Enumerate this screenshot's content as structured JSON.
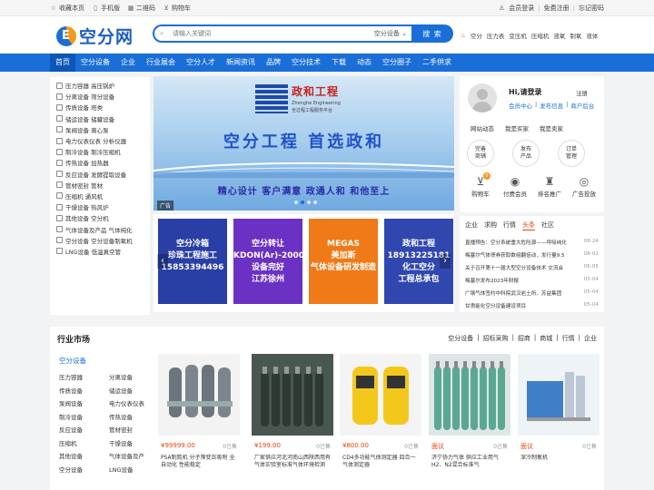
{
  "topbar": {
    "left": [
      {
        "icon": "bookmark-icon",
        "glyph": "☆",
        "label": "收藏本页"
      },
      {
        "icon": "mobile-icon",
        "glyph": "▯",
        "label": "手机版"
      },
      {
        "icon": "qrcode-icon",
        "glyph": "▦",
        "label": "二维码"
      },
      {
        "icon": "cart-icon",
        "glyph": "⊻",
        "label": "购物车"
      }
    ],
    "right": {
      "login": "会员登录",
      "register": "免费注册",
      "forgot": "忘记密码"
    }
  },
  "header": {
    "logo_text": "空分网",
    "search_placeholder": "请输入关键词",
    "search_category": "空分设备 ⌄",
    "search_button": "搜 索"
  },
  "hotwords": {
    "items": [
      "空分",
      "压力表",
      "变压机",
      "压缩机",
      "液氧",
      "制氧",
      "液体"
    ]
  },
  "nav": {
    "items": [
      "首页",
      "空分设备",
      "企业",
      "行业展会",
      "空分人才",
      "新闻资讯",
      "品牌",
      "空分技术",
      "下载",
      "动态",
      "空分圈子",
      "二手供求"
    ]
  },
  "categories": [
    "压力容器 高压锅炉",
    "分离设备 筛分设备",
    "传质设备 塔类",
    "储运设备 储藏设备",
    "泵阀设备 离心泵",
    "电力仪表仪表 分析仪器",
    "制冷设备 制冷压缩机",
    "传热设备 加热器",
    "反应设备 发酵提取设备",
    "管材密封 管材",
    "压缩机 通风机",
    "干燥设备 热风炉",
    "其他设备 空分机",
    "气体设备及产品 气体纯化",
    "空分设备 空分设备制氧机",
    "LNG设备 低温真空管"
  ],
  "banner": {
    "brand_cn": "政和工程",
    "brand_en": "Zhenghe Engineering",
    "brand_sub": "全过程工程服务平台",
    "title": "空分工程 首选政和",
    "slogan": "精心设计 客户满意 政通人和 和他至上",
    "ad_tag": "广告"
  },
  "tiles": [
    {
      "bg": "#2a3fa5",
      "text": "空分冷箱\n珍珠工程施工\n15853394496"
    },
    {
      "bg": "#6b31c4",
      "text": "空分转让\nKDON(Ar)-20000\n设备完好\n江苏徐州"
    },
    {
      "bg": "#f07a17",
      "text": "MEGAS\n美加斯\n气体设备研发制造"
    },
    {
      "bg": "#3047b0",
      "text": "政和工程\n18913225181\n化工空分\n工程总承包"
    }
  ],
  "user": {
    "greeting": "Hi,请登录",
    "register": "注册",
    "links": [
      "会员中心",
      "发布信息",
      "商户后台"
    ],
    "tabs": [
      "网站动态",
      "我是买家",
      "我是卖家"
    ],
    "circles": [
      "完善\n商铺",
      "发布\n产品",
      "订单\n管理"
    ],
    "icons": [
      {
        "name": "cart-icon",
        "glyph": "⊻",
        "label": "购物车",
        "badge": "0"
      },
      {
        "name": "wallet-icon",
        "glyph": "◉",
        "label": "付费会员"
      },
      {
        "name": "rank-icon",
        "glyph": "♜",
        "label": "排名推广"
      },
      {
        "name": "ad-icon",
        "glyph": "◎",
        "label": "广告投放"
      }
    ]
  },
  "news": {
    "tabs": [
      "企业",
      "求购",
      "行情",
      "头条",
      "社区"
    ],
    "active": "头条",
    "items": [
      {
        "t": "直播预告：空分系统重大危险源——呼吸纯化",
        "d": "08-24"
      },
      {
        "t": "梅塞尔气体债券获取数组翻倍动，发行量9.5",
        "d": "08-02"
      },
      {
        "t": "关于召开第十一届大型空分设备技术 交流会",
        "d": "06-05"
      },
      {
        "t": "梅塞尔发布2023年财报",
        "d": "05-04"
      },
      {
        "t": "广钢气体签约中科院武汉岩土所、苏益集团",
        "d": "05-04"
      },
      {
        "t": "甘肃能化空分设备建设项目",
        "d": "05-04"
      }
    ]
  },
  "market": {
    "title": "行业市场",
    "links": [
      "空分设备",
      "招标采购",
      "招商",
      "商城",
      "行情",
      "企业"
    ],
    "side_title": "空分设备",
    "side_items": [
      "压力容器",
      "分离设备",
      "传质设备",
      "储运设备",
      "泵阀设备",
      "电力仪表仪表",
      "制冷设备",
      "传热设备",
      "反应设备",
      "管材密封",
      "压缩机",
      "干燥设备",
      "其他设备",
      "气体设备及产",
      "空分设备",
      "LNG设备"
    ],
    "products": [
      {
        "price": "¥99999.00",
        "sold": "0已售",
        "name": "PSA制氮机 分子筛变压吸附 全自动化 性能稳定",
        "kind": "tanks"
      },
      {
        "price": "¥199.00",
        "sold": "0已售",
        "name": "厂家供应河北河南山西陕西用有气体实验室标准气体环境检测",
        "kind": "cylinders-dark"
      },
      {
        "price": "¥800.00",
        "sold": "0已售",
        "name": "CD4多功能气体测定器 四合一气体测定器",
        "kind": "detector"
      },
      {
        "price": "面议",
        "sold": "0已售",
        "name": "济宁协力气体 供应工业用气 H2、N2混合标准气",
        "kind": "cylinders-green"
      },
      {
        "price": "面议",
        "sold": "0已售",
        "name": "深冷制氧机",
        "kind": "machine"
      }
    ]
  }
}
